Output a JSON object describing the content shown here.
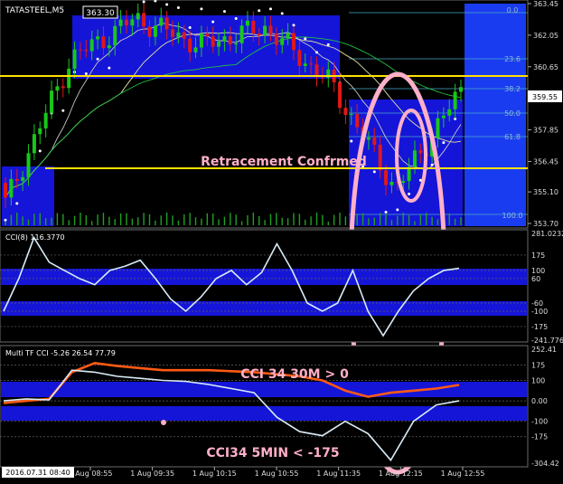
{
  "colors": {
    "background": "#000000",
    "zone_blue": "#1515d8",
    "right_blue": "#1a3cf0",
    "bull": "#18c818",
    "bear": "#e01818",
    "fib_line": "#4aa8c8",
    "sar_dots": "#ffffff",
    "yellow_level": "#ffe000",
    "annotation_pink": "#ffb0c8",
    "cci_line": "#d8ecf8",
    "cci30_line": "#ff5a14",
    "grid": "#606060"
  },
  "price_panel": {
    "symbol_label": "TATASTEEL,M5",
    "ohlc_text": "363.30",
    "current_price": "359.55",
    "annotation": "Retracement Confrmed",
    "fib_labels": [
      "0.0",
      "23.6",
      "38.2",
      "50.0",
      "61.8",
      "100.0"
    ],
    "axis_ticks": [
      "363.45",
      "362.05",
      "360.65",
      "359.25",
      "357.85",
      "356.45",
      "355.10",
      "353.70"
    ]
  },
  "cci_panel": {
    "label": "CCI(8) 116.3770",
    "axis_ticks": [
      "281.0232",
      "175",
      "100",
      "60",
      "-60",
      "-100",
      "-175",
      "-241.776"
    ]
  },
  "mtf_panel": {
    "label": "Multi TF CCI -5.26 26.54 77.79",
    "annotation_top": "CCI 34 30M > 0",
    "annotation_bottom": "CCI34 5MIN < -175",
    "axis_ticks": [
      "252.41",
      "175",
      "100",
      "0.00",
      "-100",
      "-175",
      "-304.42"
    ]
  },
  "time_axis": {
    "start_label": "2016.07.31 08:40",
    "labels": [
      "1 Aug 08:55",
      "1 Aug 09:35",
      "1 Aug 10:15",
      "1 Aug 10:55",
      "1 Aug 11:35",
      "1 Aug 12:15",
      "1 Aug 12:55"
    ]
  },
  "chart_data": [
    {
      "type": "candlestick",
      "title": "TATASTEEL,M5",
      "ylim": [
        353.7,
        363.45
      ],
      "x": [
        "2016.07.31 08:40",
        "1 Aug 08:55",
        "1 Aug 09:35",
        "1 Aug 10:15",
        "1 Aug 10:55",
        "1 Aug 11:35",
        "1 Aug 12:15",
        "1 Aug 12:55"
      ],
      "close": [
        354.6,
        361.0,
        362.8,
        361.6,
        362.4,
        359.9,
        355.2,
        359.6
      ],
      "levels": [
        360.65,
        356.45
      ],
      "last": 359.55
    },
    {
      "type": "line",
      "title": "CCI(8) 116.3770",
      "ylim": [
        -241.776,
        281.0232
      ],
      "levels": [
        175,
        100,
        60,
        -60,
        -100,
        -175
      ],
      "values": [
        -100,
        60,
        260,
        140,
        100,
        60,
        30,
        100,
        120,
        150,
        60,
        -40,
        -100,
        -30,
        60,
        100,
        30,
        90,
        230,
        100,
        -60,
        -100,
        -60,
        100,
        -100,
        -220,
        -100,
        0,
        60,
        100,
        110
      ]
    },
    {
      "type": "line",
      "title": "Multi TF CCI -5.26 26.54 77.79",
      "ylim": [
        -304.42,
        252.41
      ],
      "levels": [
        175,
        100,
        0,
        -100,
        -175
      ],
      "series": [
        {
          "values": [
            0,
            10,
            5,
            150,
            140,
            120,
            110,
            100,
            95,
            80,
            60,
            40,
            -80,
            -150,
            -170,
            -100,
            -160,
            -290,
            -100,
            -20,
            0
          ]
        },
        {
          "values": [
            -10,
            0,
            10,
            140,
            185,
            170,
            160,
            150,
            150,
            150,
            145,
            140,
            130,
            120,
            100,
            50,
            20,
            40,
            50,
            60,
            78
          ]
        }
      ]
    }
  ]
}
